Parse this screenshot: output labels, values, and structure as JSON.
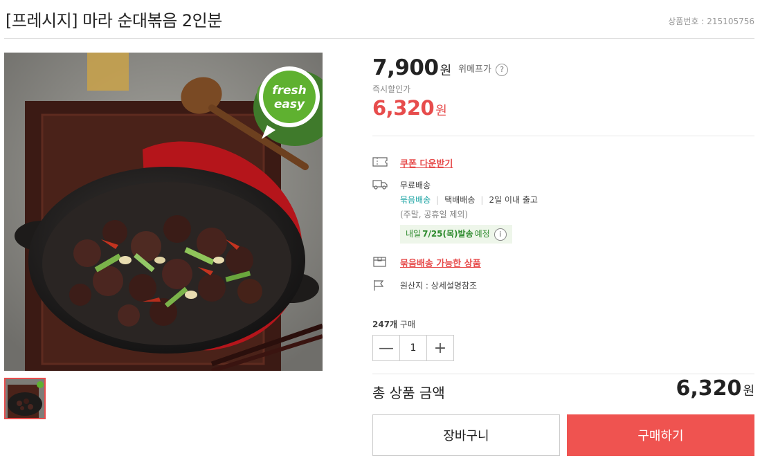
{
  "product": {
    "title": "[프레시지] 마라 순대볶음 2인분",
    "number_label": "상품번호 :",
    "number": "215105756",
    "image_alt": "마라 순대볶음",
    "fresh_logo": {
      "line1": "fresh",
      "line2": "easy"
    }
  },
  "price": {
    "original": "7,900",
    "won": "원",
    "wemep_label": "위메프가",
    "help": "?",
    "discount_label": "즉시할인가",
    "discount": "6,320"
  },
  "info": {
    "coupon_link": "쿠폰 다운받기",
    "free_shipping": "무료배송",
    "bundle_ship": "묶음배송",
    "parcel": "택배배송",
    "dispatch": "2일 이내 출고",
    "excluded": "(주말, 공휴일 제외)",
    "arrival_pre": "내일",
    "arrival_date": "7/25(목)발송",
    "arrival_post": "예정",
    "info_icon": "i",
    "bundle_link": "묶음배송 가능한 상품",
    "origin": "원산지 : 상세설명참조"
  },
  "purchase": {
    "count": "247개",
    "count_suffix": "구매",
    "quantity": "1",
    "minus": "—",
    "plus": "+",
    "total_label": "총 상품 금액",
    "total": "6,320",
    "won": "원",
    "cart_button": "장바구니",
    "buy_button": "구매하기"
  },
  "colors": {
    "accent": "#e74c4c",
    "buy": "#ef5350",
    "teal": "#1aa3a3",
    "badge_bg": "#eef6ea"
  }
}
